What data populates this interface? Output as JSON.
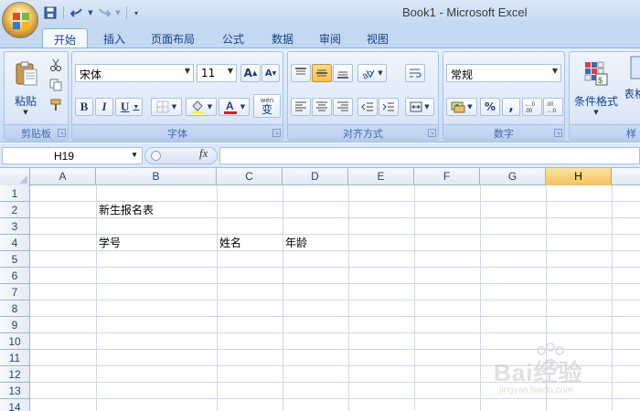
{
  "window": {
    "title": "Book1 - Microsoft Excel"
  },
  "tabs": [
    {
      "label": "开始",
      "active": true
    },
    {
      "label": "插入",
      "active": false
    },
    {
      "label": "页面布局",
      "active": false
    },
    {
      "label": "公式",
      "active": false
    },
    {
      "label": "数据",
      "active": false
    },
    {
      "label": "审阅",
      "active": false
    },
    {
      "label": "视图",
      "active": false
    }
  ],
  "ribbon": {
    "clipboard": {
      "label": "剪贴板",
      "paste_label": "粘贴"
    },
    "font": {
      "label": "字体",
      "font_name": "宋体",
      "font_size": "11",
      "bold": "B",
      "italic": "I",
      "underline": "U",
      "phonetic": "wén"
    },
    "alignment": {
      "label": "对齐方式"
    },
    "number": {
      "label": "数字",
      "format": "常规",
      "percent": "%",
      "comma": ","
    },
    "styles": {
      "cond_format_label": "条件格式",
      "next_label_part": "表格",
      "group_label_part": "样"
    }
  },
  "formula_bar": {
    "name_box": "H19",
    "fx": "fx",
    "formula": ""
  },
  "grid": {
    "columns": [
      "A",
      "B",
      "C",
      "D",
      "E",
      "F",
      "G",
      "H"
    ],
    "selected_column": "H",
    "rows": [
      "1",
      "2",
      "3",
      "4",
      "5",
      "6",
      "7",
      "8",
      "9",
      "10",
      "11",
      "12",
      "13",
      "14"
    ],
    "cells": {
      "B2": "新生报名表",
      "B4": "学号",
      "C4": "姓名",
      "D4": "年龄"
    }
  },
  "watermark": {
    "text": "Bai经验",
    "sub": "jingyan.baidu.com"
  },
  "colors": {
    "accent": "#15428b",
    "selected_header": "#f4c25a",
    "ribbon_bg": "#dce8f8"
  }
}
